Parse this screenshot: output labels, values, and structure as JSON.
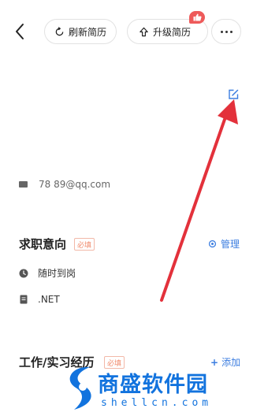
{
  "header": {
    "refresh_label": "刷新简历",
    "upgrade_label": "升级简历"
  },
  "contact": {
    "email": "78      89@qq.com"
  },
  "intent": {
    "title": "求职意向",
    "required_tag": "必填",
    "manage_label": "管理",
    "availability": "随时到岗",
    "position": ".NET"
  },
  "experience": {
    "title": "工作/实习经历",
    "required_tag": "必填",
    "add_label": "添加"
  },
  "watermark": {
    "title": "商盛软件园",
    "subtitle": "shellcn.com"
  },
  "colors": {
    "accent": "#3b7de0",
    "required": "#f08a6c",
    "annotation_arrow": "#e3313b",
    "watermark": "#1273de"
  },
  "icons": [
    "back-arrow-icon",
    "refresh-icon",
    "upload-arrow-icon",
    "thumbs-up-icon",
    "more-icon",
    "edit-icon",
    "mail-icon",
    "clock-icon",
    "document-icon",
    "gear-icon"
  ]
}
